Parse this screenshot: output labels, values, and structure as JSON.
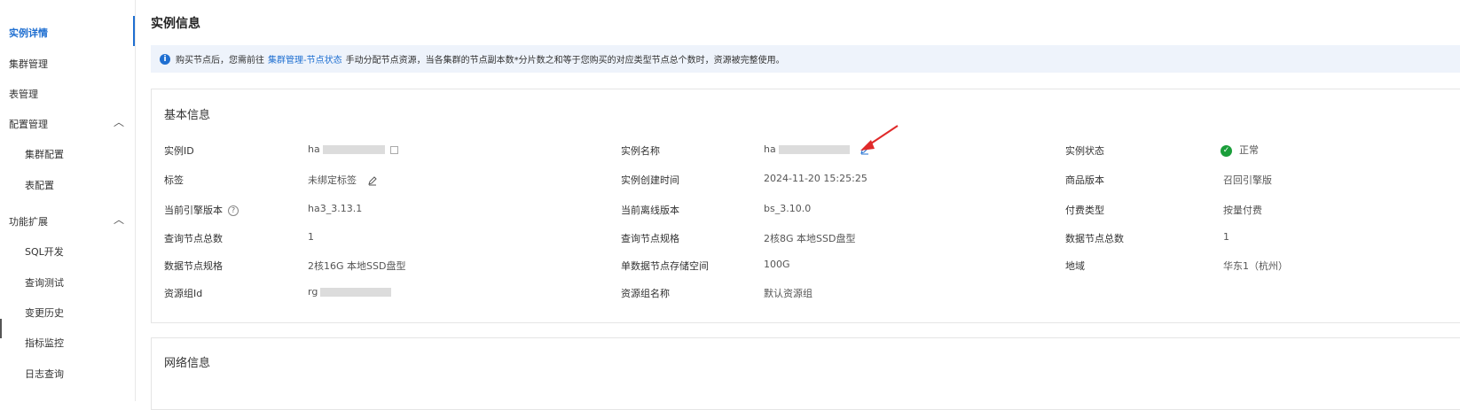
{
  "sidebar": {
    "items": [
      {
        "label": "实例详情",
        "active": true
      },
      {
        "label": "集群管理"
      },
      {
        "label": "表管理"
      },
      {
        "label": "配置管理",
        "expanded": true,
        "children": [
          "集群配置",
          "表配置"
        ]
      },
      {
        "label": "功能扩展",
        "expanded": true,
        "children": [
          "SQL开发",
          "查询测试",
          "变更历史",
          "指标监控",
          "日志查询"
        ]
      }
    ]
  },
  "page": {
    "title": "实例信息"
  },
  "notice": {
    "text_before": "购买节点后，您需前往",
    "link": "集群管理-节点状态",
    "text_after": "手动分配节点资源，当各集群的节点副本数*分片数之和等于您购买的对应类型节点总个数时，资源被完整使用。"
  },
  "basic": {
    "title": "基本信息",
    "fields": {
      "instance_id": {
        "label": "实例ID",
        "value_prefix": "ha"
      },
      "instance_name": {
        "label": "实例名称",
        "value_prefix": "ha"
      },
      "instance_status": {
        "label": "实例状态",
        "value": "正常"
      },
      "tags": {
        "label": "标签",
        "value": "未绑定标签"
      },
      "created_time": {
        "label": "实例创建时间",
        "value": "2024-11-20 15:25:25"
      },
      "product_version": {
        "label": "商品版本",
        "value": "召回引擎版"
      },
      "engine_version": {
        "label": "当前引擎版本",
        "value": "ha3_3.13.1"
      },
      "offline_version": {
        "label": "当前离线版本",
        "value": "bs_3.10.0"
      },
      "billing_type": {
        "label": "付费类型",
        "value": "按量付费"
      },
      "query_nodes": {
        "label": "查询节点总数",
        "value": "1"
      },
      "query_node_spec": {
        "label": "查询节点规格",
        "value": "2核8G 本地SSD盘型"
      },
      "data_nodes": {
        "label": "数据节点总数",
        "value": "1"
      },
      "data_node_spec": {
        "label": "数据节点规格",
        "value": "2核16G 本地SSD盘型"
      },
      "data_node_storage": {
        "label": "单数据节点存储空间",
        "value": "100G"
      },
      "region": {
        "label": "地域",
        "value": "华东1（杭州）"
      },
      "resource_group_id": {
        "label": "资源组Id",
        "value_prefix": "rg"
      },
      "resource_group_name": {
        "label": "资源组名称",
        "value": "默认资源组"
      }
    }
  },
  "network": {
    "title": "网络信息"
  },
  "colors": {
    "accent": "#1f6fd1",
    "success": "#1a9e3a",
    "annotation": "#e02a2a"
  }
}
